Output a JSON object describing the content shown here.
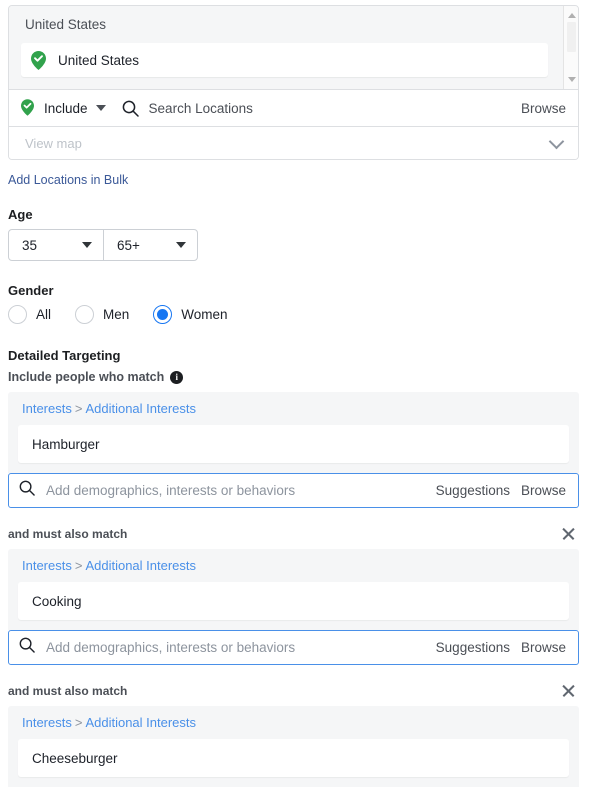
{
  "locations": {
    "country_label": "United States",
    "selected": [
      {
        "name": "United States",
        "icon": "location-pin-check-icon"
      }
    ],
    "include_label": "Include",
    "search_placeholder": "Search Locations",
    "browse_label": "Browse",
    "view_map_label": "View map",
    "bulk_link_label": "Add Locations in Bulk"
  },
  "age": {
    "title": "Age",
    "min": "35",
    "max": "65+"
  },
  "gender": {
    "title": "Gender",
    "options": [
      {
        "label": "All",
        "selected": false
      },
      {
        "label": "Men",
        "selected": false
      },
      {
        "label": "Women",
        "selected": true
      }
    ]
  },
  "detailed_targeting": {
    "title": "Detailed Targeting",
    "subtitle": "Include people who match",
    "info_glyph": "i",
    "and_must_also_match": "and must also match",
    "search_placeholder": "Add demographics, interests or behaviors",
    "suggestions_label": "Suggestions",
    "browse_label": "Browse",
    "groups": [
      {
        "crumb_root": "Interests",
        "crumb_sep": ">",
        "crumb_leaf": "Additional Interests",
        "value": "Hamburger"
      },
      {
        "crumb_root": "Interests",
        "crumb_sep": ">",
        "crumb_leaf": "Additional Interests",
        "value": "Cooking"
      },
      {
        "crumb_root": "Interests",
        "crumb_sep": ">",
        "crumb_leaf": "Additional Interests",
        "value": "Cheeseburger"
      }
    ]
  },
  "colors": {
    "accent_blue": "#1877f2",
    "link_blue": "#4a90e8",
    "bulk_link_blue": "#3b5998",
    "pin_green": "#31a24c",
    "panel_gray": "#f5f6f7",
    "border_gray": "#dddfe2"
  }
}
